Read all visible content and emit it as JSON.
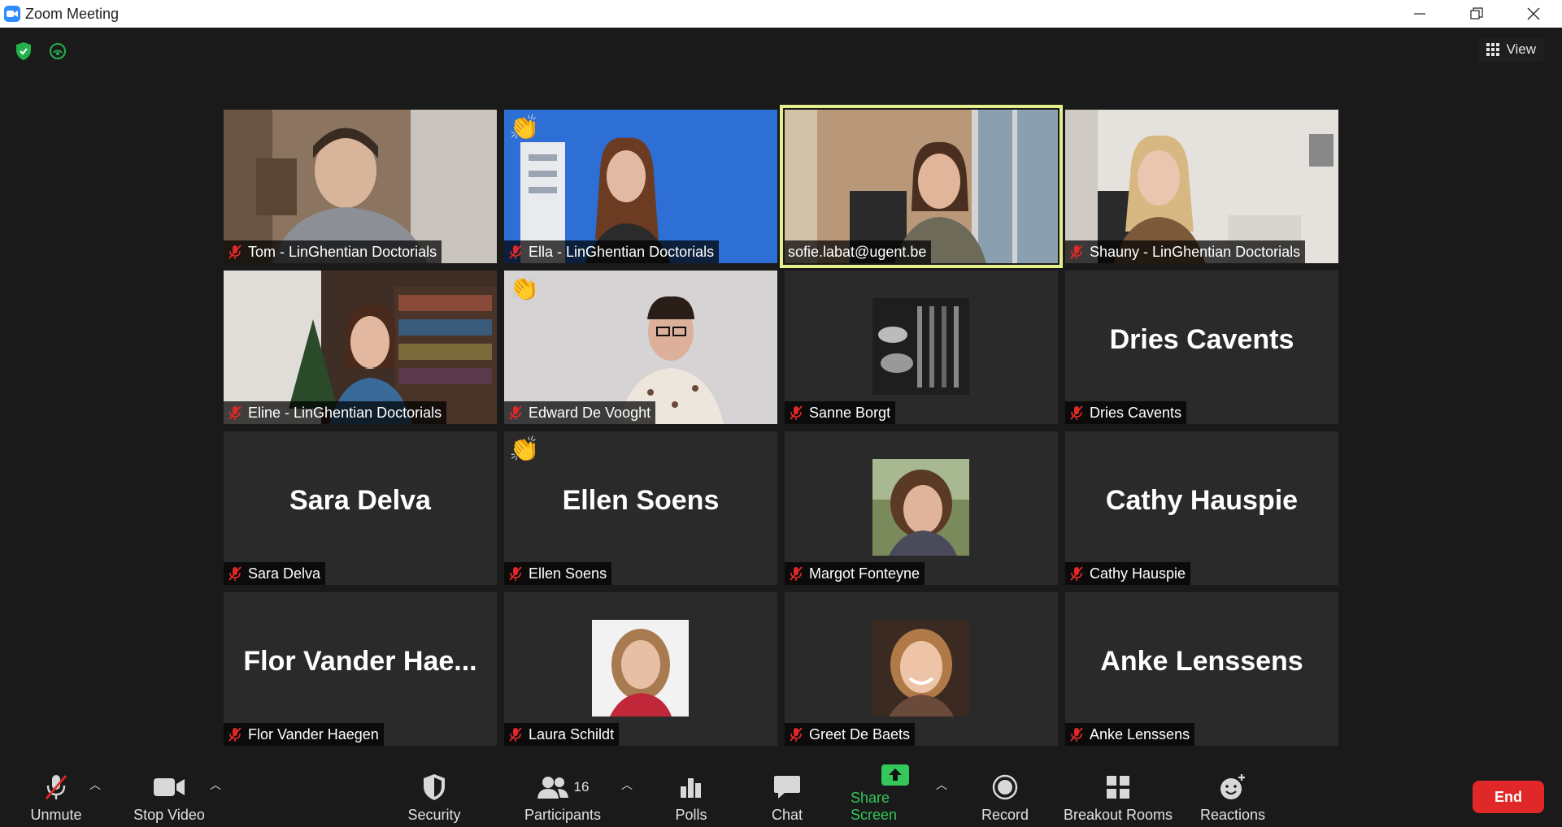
{
  "window": {
    "title": "Zoom Meeting"
  },
  "top": {
    "view_label": "View"
  },
  "tiles": [
    {
      "name": "Tom - LinGhentian Doctorials"
    },
    {
      "name": "Ella - LinGhentian Doctorials",
      "reaction": "👏"
    },
    {
      "name": "sofie.labat@ugent.be"
    },
    {
      "name": "Shauny - LinGhentian Doctorials"
    },
    {
      "name": "Eline - LinGhentian Doctorials"
    },
    {
      "name": "Edward De Vooght",
      "reaction": "👏"
    },
    {
      "name": "Sanne Borgt"
    },
    {
      "name": "Dries Cavents",
      "big": "Dries Cavents"
    },
    {
      "name": "Sara Delva",
      "big": "Sara Delva"
    },
    {
      "name": "Ellen Soens",
      "big": "Ellen Soens",
      "reaction": "👏"
    },
    {
      "name": "Margot Fonteyne"
    },
    {
      "name": "Cathy Hauspie",
      "big": "Cathy Hauspie"
    },
    {
      "name": "Flor Vander Haegen",
      "big": "Flor Vander Hae..."
    },
    {
      "name": "Laura Schildt"
    },
    {
      "name": "Greet De Baets"
    },
    {
      "name": "Anke Lenssens",
      "big": "Anke Lenssens"
    }
  ],
  "toolbar": {
    "unmute": "Unmute",
    "stop_video": "Stop Video",
    "security": "Security",
    "participants": "Participants",
    "participants_count": "16",
    "polls": "Polls",
    "chat": "Chat",
    "share_screen": "Share Screen",
    "record": "Record",
    "breakout_rooms": "Breakout Rooms",
    "reactions": "Reactions",
    "end": "End"
  },
  "colors": {
    "end": "#e02828",
    "share": "#34c759",
    "active_speaker": "#e5f08c",
    "muted": "#e02828"
  }
}
